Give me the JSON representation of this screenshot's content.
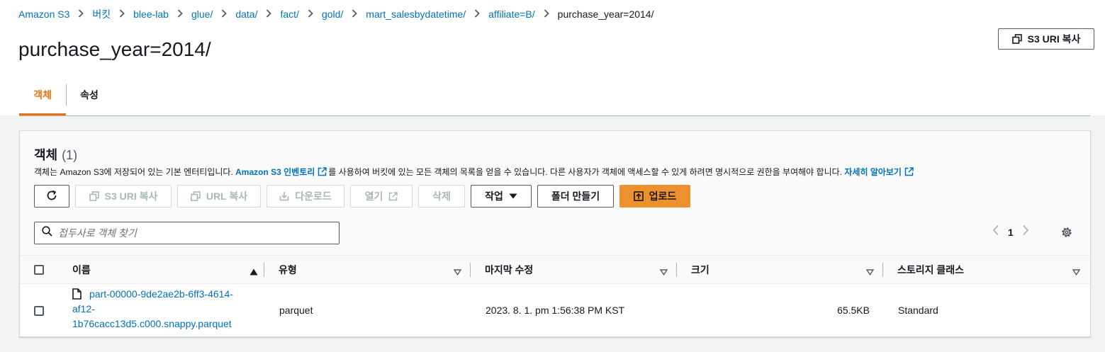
{
  "breadcrumb": [
    {
      "label": "Amazon S3"
    },
    {
      "label": "버킷"
    },
    {
      "label": "blee-lab"
    },
    {
      "label": "glue/"
    },
    {
      "label": "data/"
    },
    {
      "label": "fact/"
    },
    {
      "label": "gold/"
    },
    {
      "label": "mart_salesbydatetime/"
    },
    {
      "label": "affiliate=B/"
    }
  ],
  "breadcrumb_current": "purchase_year=2014/",
  "page_title": "purchase_year=2014/",
  "header": {
    "copy_uri_label": "S3 URI 복사"
  },
  "tabs": {
    "objects": "객체",
    "properties": "속성"
  },
  "panel": {
    "title": "객체",
    "count": "(1)",
    "desc_prefix": "객체는 Amazon S3에 저장되어 있는 기본 엔터티입니다.",
    "inventory_link": "Amazon S3 인벤토리",
    "desc_middle": "를 사용하여 버킷에 있는 모든 객체의 목록을 얻을 수 있습니다. 다른 사용자가 객체에 액세스할 수 있게 하려면 명시적으로 권한을 부여해야 합니다.",
    "learn_more": "자세히 알아보기"
  },
  "toolbar": {
    "copy_s3_uri": "S3 URI 복사",
    "copy_url": "URL 복사",
    "download": "다운로드",
    "open": "열기",
    "delete": "삭제",
    "actions": "작업",
    "create_folder": "폴더 만들기",
    "upload": "업로드"
  },
  "search": {
    "placeholder": "접두사로 객체 찾기",
    "value": ""
  },
  "pagination": {
    "current_page": "1"
  },
  "table": {
    "columns": [
      "이름",
      "유형",
      "마지막 수정",
      "크기",
      "스토리지 클래스"
    ],
    "rows": [
      {
        "name_lines": [
          "part-00000-9de2ae2b-6ff3-4614-",
          "af12-",
          "1b76cacc13d5.c000.snappy.parquet"
        ],
        "type": "parquet",
        "last_modified": "2023. 8. 1. pm 1:56:38 PM KST",
        "size": "65.5KB",
        "storage_class": "Standard"
      }
    ]
  },
  "colors": {
    "link": "#0073bb",
    "accent": "#ec7211",
    "primary_button": "#ec912d"
  }
}
